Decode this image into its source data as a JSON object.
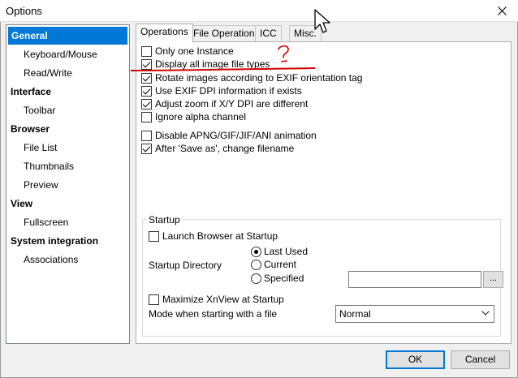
{
  "window": {
    "title": "Options",
    "close_icon": "close-icon"
  },
  "nav": {
    "items": [
      {
        "label": "General",
        "kind": "group",
        "selected": true
      },
      {
        "label": "Keyboard/Mouse",
        "kind": "child"
      },
      {
        "label": "Read/Write",
        "kind": "child"
      },
      {
        "label": "Interface",
        "kind": "group"
      },
      {
        "label": "Toolbar",
        "kind": "child"
      },
      {
        "label": "Browser",
        "kind": "group"
      },
      {
        "label": "File List",
        "kind": "child"
      },
      {
        "label": "Thumbnails",
        "kind": "child"
      },
      {
        "label": "Preview",
        "kind": "child"
      },
      {
        "label": "View",
        "kind": "group"
      },
      {
        "label": "Fullscreen",
        "kind": "child"
      },
      {
        "label": "System integration",
        "kind": "group"
      },
      {
        "label": "Associations",
        "kind": "child"
      }
    ]
  },
  "tabs": [
    {
      "label": "Operations",
      "active": true
    },
    {
      "label": "File Operations"
    },
    {
      "label": "ICC"
    },
    {
      "label": "Misc."
    }
  ],
  "operations": {
    "options": [
      {
        "label": "Only one Instance",
        "checked": false
      },
      {
        "label": "Display all image file types",
        "checked": true
      },
      {
        "label": "Rotate images according to EXIF orientation tag",
        "checked": true
      },
      {
        "label": "Use EXIF DPI information if exists",
        "checked": true
      },
      {
        "label": "Adjust zoom if X/Y DPI are different",
        "checked": true
      },
      {
        "label": "Ignore alpha channel",
        "checked": false
      },
      {
        "label": "Disable APNG/GIF/JIF/ANI animation",
        "checked": false
      },
      {
        "label": "After 'Save as', change filename",
        "checked": true
      }
    ]
  },
  "startup": {
    "title": "Startup",
    "launch_browser": {
      "label": "Launch Browser at Startup",
      "checked": false
    },
    "directory_label": "Startup Directory",
    "directory_options": [
      {
        "label": "Last Used",
        "checked": true
      },
      {
        "label": "Current",
        "checked": false
      },
      {
        "label": "Specified",
        "checked": false
      }
    ],
    "specified_path": "",
    "browse_label": "...",
    "maximize": {
      "label": "Maximize XnView at Startup",
      "checked": false
    },
    "mode_label": "Mode when starting with a file",
    "mode_value": "Normal"
  },
  "buttons": {
    "ok": "OK",
    "cancel": "Cancel"
  },
  "annotation": {
    "mark": "?",
    "color": "#d40000"
  }
}
